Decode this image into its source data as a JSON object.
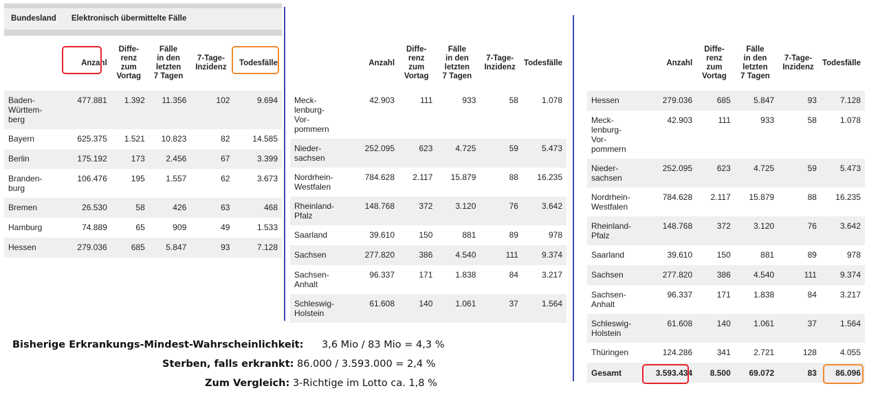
{
  "columns": [
    "Anzahl",
    "Diffe-\nrenz\nzum\nVortag",
    "Fälle\nin den\nletzten\n7 Tagen",
    "7-Tage-\nInzidenz",
    "Todesfälle"
  ],
  "header": {
    "bundesland": "Bundesland",
    "group": "Elektronisch übermittelte Fälle"
  },
  "table1": [
    {
      "name": "Baden-\nWürttem-\nberg",
      "anzahl": "477.881",
      "diff": "1.392",
      "faelle7": "11.356",
      "inz": "102",
      "tod": "9.694"
    },
    {
      "name": "Bayern",
      "anzahl": "625.375",
      "diff": "1.521",
      "faelle7": "10.823",
      "inz": "82",
      "tod": "14.585"
    },
    {
      "name": "Berlin",
      "anzahl": "175.192",
      "diff": "173",
      "faelle7": "2.456",
      "inz": "67",
      "tod": "3.399"
    },
    {
      "name": "Branden-\nburg",
      "anzahl": "106.476",
      "diff": "195",
      "faelle7": "1.557",
      "inz": "62",
      "tod": "3.673"
    },
    {
      "name": "Bremen",
      "anzahl": "26.530",
      "diff": "58",
      "faelle7": "426",
      "inz": "63",
      "tod": "468"
    },
    {
      "name": "Hamburg",
      "anzahl": "74.889",
      "diff": "65",
      "faelle7": "909",
      "inz": "49",
      "tod": "1.533"
    },
    {
      "name": "Hessen",
      "anzahl": "279.036",
      "diff": "685",
      "faelle7": "5.847",
      "inz": "93",
      "tod": "7.128"
    }
  ],
  "table2": [
    {
      "name": "Meck-\nlenburg-\nVor-\npommern",
      "anzahl": "42.903",
      "diff": "111",
      "faelle7": "933",
      "inz": "58",
      "tod": "1.078"
    },
    {
      "name": "Nieder-\nsachsen",
      "anzahl": "252.095",
      "diff": "623",
      "faelle7": "4.725",
      "inz": "59",
      "tod": "5.473"
    },
    {
      "name": "Nordrhein-\nWestfalen",
      "anzahl": "784.628",
      "diff": "2.117",
      "faelle7": "15.879",
      "inz": "88",
      "tod": "16.235"
    },
    {
      "name": "Rheinland-\nPfalz",
      "anzahl": "148.768",
      "diff": "372",
      "faelle7": "3.120",
      "inz": "76",
      "tod": "3.642"
    },
    {
      "name": "Saarland",
      "anzahl": "39.610",
      "diff": "150",
      "faelle7": "881",
      "inz": "89",
      "tod": "978"
    },
    {
      "name": "Sachsen",
      "anzahl": "277.820",
      "diff": "386",
      "faelle7": "4.540",
      "inz": "111",
      "tod": "9.374"
    },
    {
      "name": "Sachsen-\nAnhalt",
      "anzahl": "96.337",
      "diff": "171",
      "faelle7": "1.838",
      "inz": "84",
      "tod": "3.217"
    },
    {
      "name": "Schleswig-\nHolstein",
      "anzahl": "61.608",
      "diff": "140",
      "faelle7": "1.061",
      "inz": "37",
      "tod": "1.564"
    }
  ],
  "table3": [
    {
      "name": "Hessen",
      "anzahl": "279.036",
      "diff": "685",
      "faelle7": "5.847",
      "inz": "93",
      "tod": "7.128"
    },
    {
      "name": "Meck-\nlenburg-\nVor-\npommern",
      "anzahl": "42.903",
      "diff": "111",
      "faelle7": "933",
      "inz": "58",
      "tod": "1.078"
    },
    {
      "name": "Nieder-\nsachsen",
      "anzahl": "252.095",
      "diff": "623",
      "faelle7": "4.725",
      "inz": "59",
      "tod": "5.473"
    },
    {
      "name": "Nordrhein-\nWestfalen",
      "anzahl": "784.628",
      "diff": "2.117",
      "faelle7": "15.879",
      "inz": "88",
      "tod": "16.235"
    },
    {
      "name": "Rheinland-\nPfalz",
      "anzahl": "148.768",
      "diff": "372",
      "faelle7": "3.120",
      "inz": "76",
      "tod": "3.642"
    },
    {
      "name": "Saarland",
      "anzahl": "39.610",
      "diff": "150",
      "faelle7": "881",
      "inz": "89",
      "tod": "978"
    },
    {
      "name": "Sachsen",
      "anzahl": "277.820",
      "diff": "386",
      "faelle7": "4.540",
      "inz": "111",
      "tod": "9.374"
    },
    {
      "name": "Sachsen-\nAnhalt",
      "anzahl": "96.337",
      "diff": "171",
      "faelle7": "1.838",
      "inz": "84",
      "tod": "3.217"
    },
    {
      "name": "Schleswig-\nHolstein",
      "anzahl": "61.608",
      "diff": "140",
      "faelle7": "1.061",
      "inz": "37",
      "tod": "1.564"
    },
    {
      "name": "Thüringen",
      "anzahl": "124.286",
      "diff": "341",
      "faelle7": "2.721",
      "inz": "128",
      "tod": "4.055"
    },
    {
      "name": "Gesamt",
      "anzahl": "3.593.434",
      "diff": "8.500",
      "faelle7": "69.072",
      "inz": "83",
      "tod": "86.096"
    }
  ],
  "bottom": {
    "line1_label": "Bisherige Erkrankungs-Mindest-Wahrscheinlichkeit:",
    "line1_value": "3,6 Mio / 83 Mio = 4,3 %",
    "line2_label": "Sterben, falls erkrankt:",
    "line2_value": "86.000 / 3.593.000 = 2,4 %",
    "line3_label": "Zum Vergleich:",
    "line3_value": "3-Richtige im Lotto ca. 1,8 %"
  },
  "colors": {
    "divider": "#3b47b0",
    "highlight_red": "#e8212b",
    "highlight_orange": "#f08a2e",
    "row_shade": "#efefef"
  }
}
